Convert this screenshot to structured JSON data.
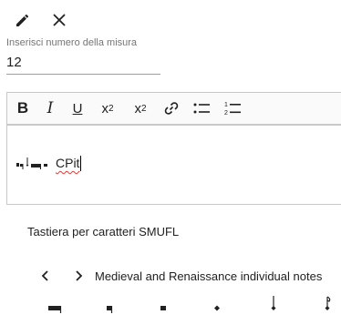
{
  "toolbar_top": {
    "edit_icon": "pencil-icon",
    "close_icon": "close-icon"
  },
  "measure_field": {
    "label": "Inserisci numero della misura",
    "value": "12"
  },
  "format_toolbar": {
    "bold": "B",
    "italic": "I",
    "underline": "U",
    "subscript_base": "x",
    "subscript_mark": "2",
    "superscript_base": "x",
    "superscript_mark": "2",
    "link_icon": "link-icon",
    "bullet_list_icon": "bullet-list-icon",
    "numbered_list_icon": "numbered-list-icon"
  },
  "editor": {
    "text": "CPit"
  },
  "smufl_panel": {
    "title": "Tastiera per caratteri SMUFL",
    "prev_icon": "chevron-left-icon",
    "next_icon": "chevron-right-icon",
    "category": "Medieval and Renaissance individual notes",
    "glyphs": [
      "maxima-note",
      "longa-note",
      "brevis-note",
      "semibrevis-note",
      "minima-note",
      "semiminima-note"
    ]
  }
}
